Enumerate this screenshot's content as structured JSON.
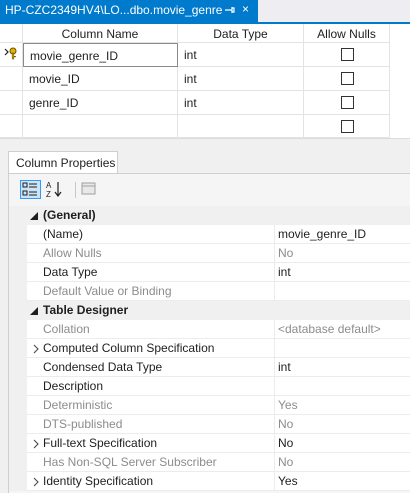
{
  "document_tab": {
    "title": "HP-CZC2349HV4\\LO...dbo.movie_genre",
    "pin_icon": "pin-icon",
    "close_glyph": "×"
  },
  "table_grid": {
    "headers": [
      "Column Name",
      "Data Type",
      "Allow Nulls"
    ],
    "rows": [
      {
        "name": "movie_genre_ID",
        "type": "int",
        "allow_nulls": false,
        "primary_key": true
      },
      {
        "name": "movie_ID",
        "type": "int",
        "allow_nulls": false,
        "primary_key": false
      },
      {
        "name": "genre_ID",
        "type": "int",
        "allow_nulls": false,
        "primary_key": false
      },
      {
        "name": "",
        "type": "",
        "allow_nulls": false,
        "primary_key": false
      }
    ]
  },
  "properties": {
    "tab_label": "Column Properties",
    "toolbar": [
      "categorized-icon",
      "alphabetical-sort-icon",
      "property-pages-icon"
    ],
    "categories": [
      {
        "label": "(General)",
        "items": [
          {
            "name": "(Name)",
            "value": "movie_genre_ID",
            "enabled": true,
            "expandable": false
          },
          {
            "name": "Allow Nulls",
            "value": "No",
            "enabled": false,
            "expandable": false
          },
          {
            "name": "Data Type",
            "value": "int",
            "enabled": true,
            "expandable": false
          },
          {
            "name": "Default Value or Binding",
            "value": "",
            "enabled": false,
            "expandable": false
          }
        ]
      },
      {
        "label": "Table Designer",
        "items": [
          {
            "name": "Collation",
            "value": "<database default>",
            "enabled": false,
            "expandable": false
          },
          {
            "name": "Computed Column Specification",
            "value": "",
            "enabled": true,
            "expandable": true
          },
          {
            "name": "Condensed Data Type",
            "value": "int",
            "enabled": true,
            "expandable": false
          },
          {
            "name": "Description",
            "value": "",
            "enabled": true,
            "expandable": false
          },
          {
            "name": "Deterministic",
            "value": "Yes",
            "enabled": false,
            "expandable": false
          },
          {
            "name": "DTS-published",
            "value": "No",
            "enabled": false,
            "expandable": false
          },
          {
            "name": "Full-text Specification",
            "value": "No",
            "enabled": true,
            "expandable": true
          },
          {
            "name": "Has Non-SQL Server Subscriber",
            "value": "No",
            "enabled": false,
            "expandable": false
          },
          {
            "name": "Identity Specification",
            "value": "Yes",
            "enabled": true,
            "expandable": true
          }
        ]
      }
    ]
  },
  "colors": {
    "accent": "#007acc",
    "disabled_text": "#8c8c8c",
    "pane_background": "#f0f0f0"
  }
}
